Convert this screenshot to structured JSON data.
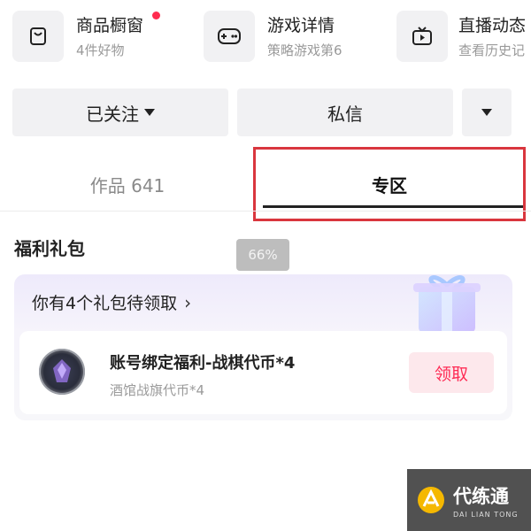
{
  "top_tiles": [
    {
      "title": "商品橱窗",
      "subtitle": "4件好物",
      "icon": "shopping-bag-icon",
      "has_dot": true
    },
    {
      "title": "游戏详情",
      "subtitle": "策略游戏第6",
      "icon": "gamepad-icon",
      "has_dot": false
    },
    {
      "title": "直播动态",
      "subtitle": "查看历史记",
      "icon": "tv-icon",
      "has_dot": false
    }
  ],
  "actions": {
    "follow_label": "已关注",
    "message_label": "私信"
  },
  "tabs": {
    "works_label": "作品 641",
    "zone_label": "专区"
  },
  "section": {
    "title": "福利礼包"
  },
  "zoom_badge": "66%",
  "gift": {
    "header": "你有4个礼包待领取",
    "item_title": "账号绑定福利-战棋代币*4",
    "item_subtitle": "酒馆战旗代币*4",
    "claim_label": "领取"
  },
  "watermark": {
    "title": "代练通",
    "subtitle": "DAI LIAN TONG"
  },
  "colors": {
    "accent": "#fe2c55",
    "highlight_border": "#d9363e",
    "notification_dot": "#ff2b4f"
  }
}
